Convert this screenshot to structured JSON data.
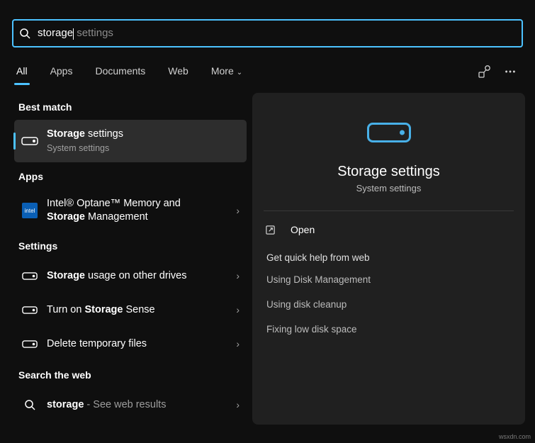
{
  "search": {
    "typed": "storage",
    "suggestion": " settings"
  },
  "tabs": {
    "all": "All",
    "apps": "Apps",
    "documents": "Documents",
    "web": "Web",
    "more": "More"
  },
  "sections": {
    "best_match": "Best match",
    "apps": "Apps",
    "settings": "Settings",
    "search_web": "Search the web"
  },
  "best_match": {
    "title_bold": "Storage",
    "title_rest": " settings",
    "subtitle": "System settings"
  },
  "apps_results": [
    {
      "line1_pre": "Intel® Optane™ Memory and ",
      "line1_bold": "",
      "line2_bold": "Storage",
      "line2_rest": " Management"
    }
  ],
  "settings_results": [
    {
      "bold": "Storage",
      "rest": " usage on other drives"
    },
    {
      "pre": "Turn on ",
      "bold": "Storage",
      "rest": " Sense"
    },
    {
      "pre": "",
      "bold": "",
      "rest": "Delete temporary files"
    }
  ],
  "web_result": {
    "bold": "storage",
    "rest": " - See web results"
  },
  "detail": {
    "title": "Storage settings",
    "subtitle": "System settings",
    "open": "Open",
    "help_title": "Get quick help from web",
    "help_links": [
      "Using Disk Management",
      "Using disk cleanup",
      "Fixing low disk space"
    ]
  },
  "watermark": "wsxdn.com"
}
